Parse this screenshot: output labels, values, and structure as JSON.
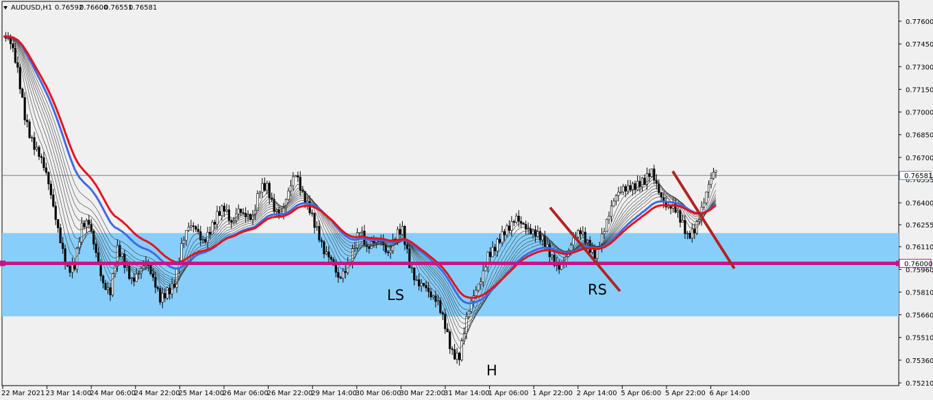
{
  "header": {
    "symbol_label": "AUDUSD,H1",
    "open": "0.76592",
    "high": "0.76600",
    "low": "0.76551",
    "close": "0.76581"
  },
  "colors": {
    "background": "#f0f0f0",
    "zone_fill": "#87cefa",
    "level_line": "#c71585",
    "ema_slow": "#e8101a",
    "ema_fast": "#4169e1",
    "ribbon": "#3a3a3a",
    "trendline": "#b22222",
    "bull_candle": "#ffffff",
    "bear_candle": "#000000"
  },
  "price_axis": {
    "ticks": [
      "0.77600",
      "0.77450",
      "0.77300",
      "0.77150",
      "0.77000",
      "0.76850",
      "0.76700",
      "0.76555",
      "0.76400",
      "0.76255",
      "0.76110",
      "0.75960",
      "0.75810",
      "0.75660",
      "0.75510",
      "0.75360",
      "0.75210"
    ],
    "current_price_label": "0.76581",
    "level_label": "0.76000"
  },
  "time_axis": {
    "ticks": [
      "22 Mar 2021",
      "23 Mar 14:00",
      "24 Mar 06:00",
      "24 Mar 22:00",
      "25 Mar 14:00",
      "26 Mar 06:00",
      "26 Mar 22:00",
      "29 Mar 14:00",
      "30 Mar 06:00",
      "30 Mar 22:00",
      "31 Mar 14:00",
      "1 Apr 06:00",
      "1 Apr 22:00",
      "2 Apr 14:00",
      "5 Apr 06:00",
      "5 Apr 22:00",
      "6 Apr 14:00"
    ]
  },
  "annotations": {
    "left_shoulder": "LS",
    "head": "H",
    "right_shoulder": "RS"
  },
  "chart_data": {
    "type": "candlestick",
    "title": "AUDUSD,H1",
    "y_range": [
      0.752,
      0.777
    ],
    "support_zone": [
      0.7565,
      0.762
    ],
    "horizontal_level": 0.76,
    "current_price": 0.76581,
    "close_path": [
      [
        0,
        0.775
      ],
      [
        3,
        0.7742
      ],
      [
        6,
        0.7725
      ],
      [
        9,
        0.77
      ],
      [
        12,
        0.7685
      ],
      [
        15,
        0.7672
      ],
      [
        18,
        0.7655
      ],
      [
        21,
        0.7635
      ],
      [
        24,
        0.7618
      ],
      [
        27,
        0.76
      ],
      [
        30,
        0.7598
      ],
      [
        33,
        0.762
      ],
      [
        36,
        0.7625
      ],
      [
        39,
        0.761
      ],
      [
        42,
        0.759
      ],
      [
        45,
        0.758
      ],
      [
        48,
        0.7605
      ],
      [
        51,
        0.7598
      ],
      [
        54,
        0.7592
      ],
      [
        57,
        0.7598
      ],
      [
        60,
        0.76
      ],
      [
        63,
        0.7585
      ],
      [
        66,
        0.7575
      ],
      [
        69,
        0.7585
      ],
      [
        72,
        0.759
      ],
      [
        75,
        0.761
      ],
      [
        78,
        0.762
      ],
      [
        81,
        0.7622
      ],
      [
        84,
        0.7618
      ],
      [
        87,
        0.7625
      ],
      [
        90,
        0.763
      ],
      [
        93,
        0.7632
      ],
      [
        96,
        0.7625
      ],
      [
        99,
        0.764
      ],
      [
        102,
        0.7635
      ],
      [
        105,
        0.7628
      ],
      [
        108,
        0.7645
      ],
      [
        111,
        0.765
      ],
      [
        114,
        0.764
      ],
      [
        117,
        0.7635
      ],
      [
        120,
        0.7645
      ],
      [
        123,
        0.7655
      ],
      [
        126,
        0.7645
      ],
      [
        129,
        0.764
      ],
      [
        132,
        0.7625
      ],
      [
        135,
        0.7605
      ],
      [
        138,
        0.7598
      ],
      [
        141,
        0.759
      ],
      [
        144,
        0.76
      ],
      [
        147,
        0.761
      ],
      [
        150,
        0.762
      ],
      [
        153,
        0.7605
      ],
      [
        156,
        0.7615
      ],
      [
        159,
        0.762
      ],
      [
        162,
        0.7608
      ],
      [
        165,
        0.7615
      ],
      [
        168,
        0.7618
      ],
      [
        171,
        0.76
      ],
      [
        174,
        0.7592
      ],
      [
        177,
        0.7588
      ],
      [
        180,
        0.7575
      ],
      [
        183,
        0.757
      ],
      [
        186,
        0.756
      ],
      [
        189,
        0.7545
      ],
      [
        192,
        0.754
      ],
      [
        195,
        0.756
      ],
      [
        198,
        0.7575
      ],
      [
        201,
        0.759
      ],
      [
        204,
        0.761
      ],
      [
        207,
        0.7612
      ],
      [
        210,
        0.7615
      ],
      [
        213,
        0.762
      ],
      [
        216,
        0.7632
      ],
      [
        219,
        0.763
      ],
      [
        222,
        0.7622
      ],
      [
        225,
        0.7615
      ],
      [
        228,
        0.761
      ],
      [
        231,
        0.7605
      ],
      [
        234,
        0.7602
      ],
      [
        237,
        0.7605
      ],
      [
        240,
        0.7612
      ],
      [
        243,
        0.7618
      ],
      [
        246,
        0.7615
      ],
      [
        249,
        0.761
      ],
      [
        252,
        0.7618
      ],
      [
        255,
        0.7628
      ],
      [
        258,
        0.7642
      ],
      [
        261,
        0.7652
      ],
      [
        264,
        0.7655
      ],
      [
        267,
        0.7652
      ],
      [
        270,
        0.765
      ],
      [
        273,
        0.7658
      ],
      [
        276,
        0.765
      ],
      [
        279,
        0.7642
      ],
      [
        282,
        0.7638
      ],
      [
        285,
        0.7625
      ],
      [
        288,
        0.7615
      ],
      [
        291,
        0.7625
      ],
      [
        294,
        0.764
      ],
      [
        297,
        0.7652
      ],
      [
        300,
        0.7658
      ]
    ]
  }
}
